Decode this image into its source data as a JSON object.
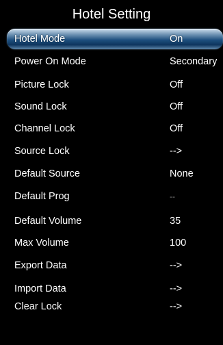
{
  "title": "Hotel Setting",
  "accent_color": "#1d4f7e",
  "items": [
    {
      "label": "Hotel Mode",
      "value": "On",
      "selected": true
    },
    {
      "label": "Power On Mode",
      "value": "Secondary"
    },
    {
      "label": "Picture Lock",
      "value": "Off"
    },
    {
      "label": "Sound Lock",
      "value": "Off"
    },
    {
      "label": "Channel Lock",
      "value": "Off"
    },
    {
      "label": "Source Lock",
      "value": "-->"
    },
    {
      "label": "Default Source",
      "value": "None"
    },
    {
      "label": "Default Prog",
      "value": "--",
      "disabled": true
    },
    {
      "label": "Default Volume",
      "value": "35"
    },
    {
      "label": "Max Volume",
      "value": "100"
    },
    {
      "label": "Export Data",
      "value": "-->"
    },
    {
      "label": "Import Data",
      "value": "-->"
    },
    {
      "label": "Clear Lock",
      "value": "-->"
    }
  ]
}
